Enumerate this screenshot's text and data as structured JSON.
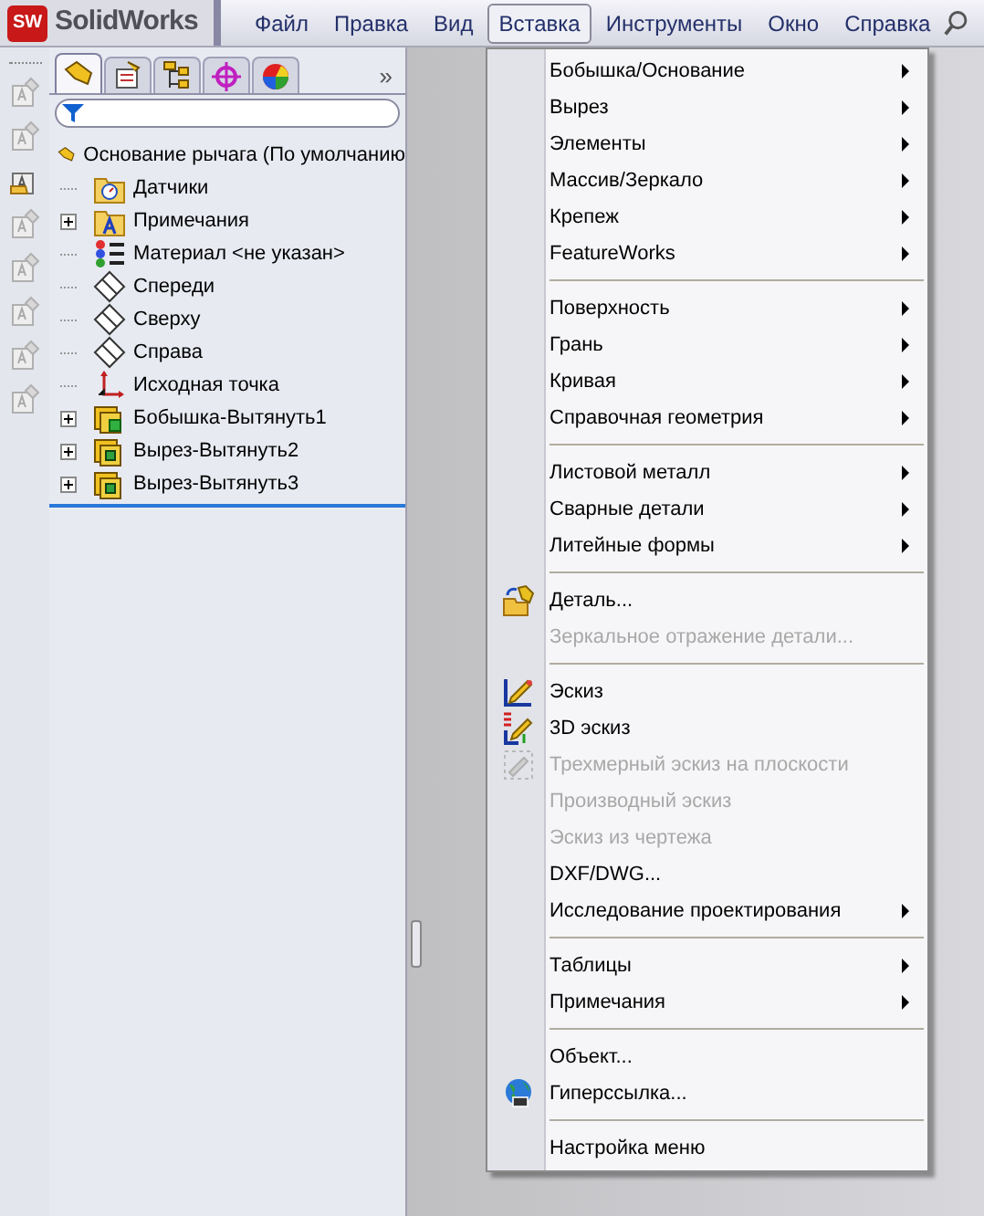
{
  "app": {
    "logo_mark": "SW",
    "logo_text": "SolidWorks"
  },
  "menu_bar": [
    {
      "label": "Файл",
      "selected": false
    },
    {
      "label": "Правка",
      "selected": false
    },
    {
      "label": "Вид",
      "selected": false
    },
    {
      "label": "Вставка",
      "selected": true
    },
    {
      "label": "Инструменты",
      "selected": false
    },
    {
      "label": "Окно",
      "selected": false
    },
    {
      "label": "Справка",
      "selected": false
    }
  ],
  "panel": {
    "tabs": [
      {
        "selected": true
      },
      {
        "selected": false
      },
      {
        "selected": false
      },
      {
        "selected": false
      },
      {
        "selected": false
      }
    ],
    "more": "»",
    "tree": {
      "label": "Основание рычага  (По умолчанию",
      "children": [
        {
          "label": "Датчики",
          "kind": "sensors"
        },
        {
          "label": "Примечания",
          "kind": "annotations",
          "expanded": false
        },
        {
          "label": "Материал <не указан>",
          "kind": "material"
        },
        {
          "label": "Спереди",
          "kind": "plane"
        },
        {
          "label": "Сверху",
          "kind": "plane"
        },
        {
          "label": "Справа",
          "kind": "plane"
        },
        {
          "label": "Исходная точка",
          "kind": "origin"
        },
        {
          "label": "Бобышка-Вытянуть1",
          "kind": "boss",
          "expanded": false
        },
        {
          "label": "Вырез-Вытянуть2",
          "kind": "cut",
          "expanded": false
        },
        {
          "label": "Вырез-Вытянуть3",
          "kind": "cut",
          "expanded": false
        }
      ]
    }
  },
  "menu": [
    {
      "kind": "item",
      "label": "Бобышка/Основание",
      "submenu": true,
      "disabled": false
    },
    {
      "kind": "item",
      "label": "Вырез",
      "submenu": true,
      "disabled": false
    },
    {
      "kind": "item",
      "label": "Элементы",
      "submenu": true,
      "disabled": false
    },
    {
      "kind": "item",
      "label": "Массив/Зеркало",
      "submenu": true,
      "disabled": false
    },
    {
      "kind": "item",
      "label": "Крепеж",
      "submenu": true,
      "disabled": false
    },
    {
      "kind": "item",
      "label": "FeatureWorks",
      "submenu": true,
      "disabled": false
    },
    {
      "kind": "separator"
    },
    {
      "kind": "item",
      "label": "Поверхность",
      "submenu": true,
      "disabled": false
    },
    {
      "kind": "item",
      "label": "Грань",
      "submenu": true,
      "disabled": false
    },
    {
      "kind": "item",
      "label": "Кривая",
      "submenu": true,
      "disabled": false
    },
    {
      "kind": "item",
      "label": "Справочная геометрия",
      "submenu": true,
      "disabled": false
    },
    {
      "kind": "separator"
    },
    {
      "kind": "item",
      "label": "Листовой металл",
      "submenu": true,
      "disabled": false
    },
    {
      "kind": "item",
      "label": "Сварные детали",
      "submenu": true,
      "disabled": false
    },
    {
      "kind": "item",
      "label": "Литейные формы",
      "submenu": true,
      "disabled": false
    },
    {
      "kind": "separator"
    },
    {
      "kind": "item",
      "label": "Деталь...",
      "submenu": false,
      "disabled": false
    },
    {
      "kind": "item",
      "label": "Зеркальное отражение детали...",
      "submenu": false,
      "disabled": true
    },
    {
      "kind": "separator"
    },
    {
      "kind": "item",
      "label": "Эскиз",
      "submenu": false,
      "disabled": false
    },
    {
      "kind": "item",
      "label": "3D эскиз",
      "submenu": false,
      "disabled": false
    },
    {
      "kind": "item",
      "label": "Трехмерный эскиз на плоскости",
      "submenu": false,
      "disabled": true
    },
    {
      "kind": "item",
      "label": "Производный эскиз",
      "submenu": false,
      "disabled": true
    },
    {
      "kind": "item",
      "label": "Эскиз из чертежа",
      "submenu": false,
      "disabled": true
    },
    {
      "kind": "item",
      "label": "DXF/DWG...",
      "submenu": false,
      "disabled": false
    },
    {
      "kind": "item",
      "label": "Исследование проектирования",
      "submenu": true,
      "disabled": false
    },
    {
      "kind": "separator"
    },
    {
      "kind": "item",
      "label": "Таблицы",
      "submenu": true,
      "disabled": false
    },
    {
      "kind": "item",
      "label": "Примечания",
      "submenu": true,
      "disabled": false
    },
    {
      "kind": "separator"
    },
    {
      "kind": "item",
      "label": "Объект...",
      "submenu": false,
      "disabled": false
    },
    {
      "kind": "item",
      "label": "Гиперссылка...",
      "submenu": false,
      "disabled": false
    },
    {
      "kind": "separator"
    },
    {
      "kind": "item",
      "label": "Настройка меню",
      "submenu": false,
      "disabled": false
    }
  ]
}
